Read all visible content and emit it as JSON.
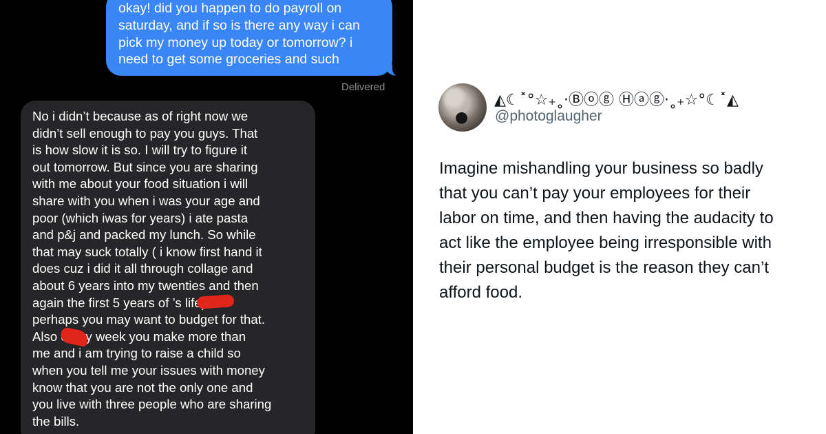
{
  "messages": {
    "outgoing": {
      "lines": [
        "okay! did you happen to do payroll on",
        "saturday, and if so is there any way i can",
        "pick my money up today or tomorrow? i",
        "need to get some groceries and such"
      ],
      "status": "Delivered"
    },
    "incoming": {
      "lines": [
        "No i didn’t because as of right now we",
        "didn’t sell enough to pay you guys.   That",
        "is how slow it is so.  I will try to figure it",
        "out tomorrow.  But since you are sharing",
        "with me about your food situation i will",
        "share with you when i was your age and",
        "poor (which iwas for years) i ate pasta",
        "and p&j and packed my lunch.  So while",
        "that may suck totally ( i know first hand it",
        "does cuz i did it all through collage and",
        "about 6 years into my twenties and then",
        "again the first  5 years of          ’s life)",
        "perhaps you may want to budget for that.",
        "Also          every week you make more than",
        "me and i am trying to raise a child so",
        "when you tell me your issues with money",
        "know that you are not the only one and",
        "you live with three people who are sharing",
        "the bills."
      ]
    },
    "colors": {
      "background": "#000000",
      "outgoing": "#3b86f7",
      "incoming": "#262628",
      "redaction": "#e0251b"
    }
  },
  "tweet": {
    "display_name": "◭☾˟°☆₊˳·Ⓑⓞⓖ Ⓗⓐⓖ·˳₊☆°☾˟◭",
    "handle": "@photoglaugher",
    "avatar_icon": "profile-photo",
    "lines": [
      "Imagine mishandling your business so badly",
      "that you can’t pay your employees for their",
      "labor on time, and then having the audacity to",
      "act like the employee being irresponsible with",
      "their personal budget is the reason they can’t",
      "afford food."
    ]
  }
}
